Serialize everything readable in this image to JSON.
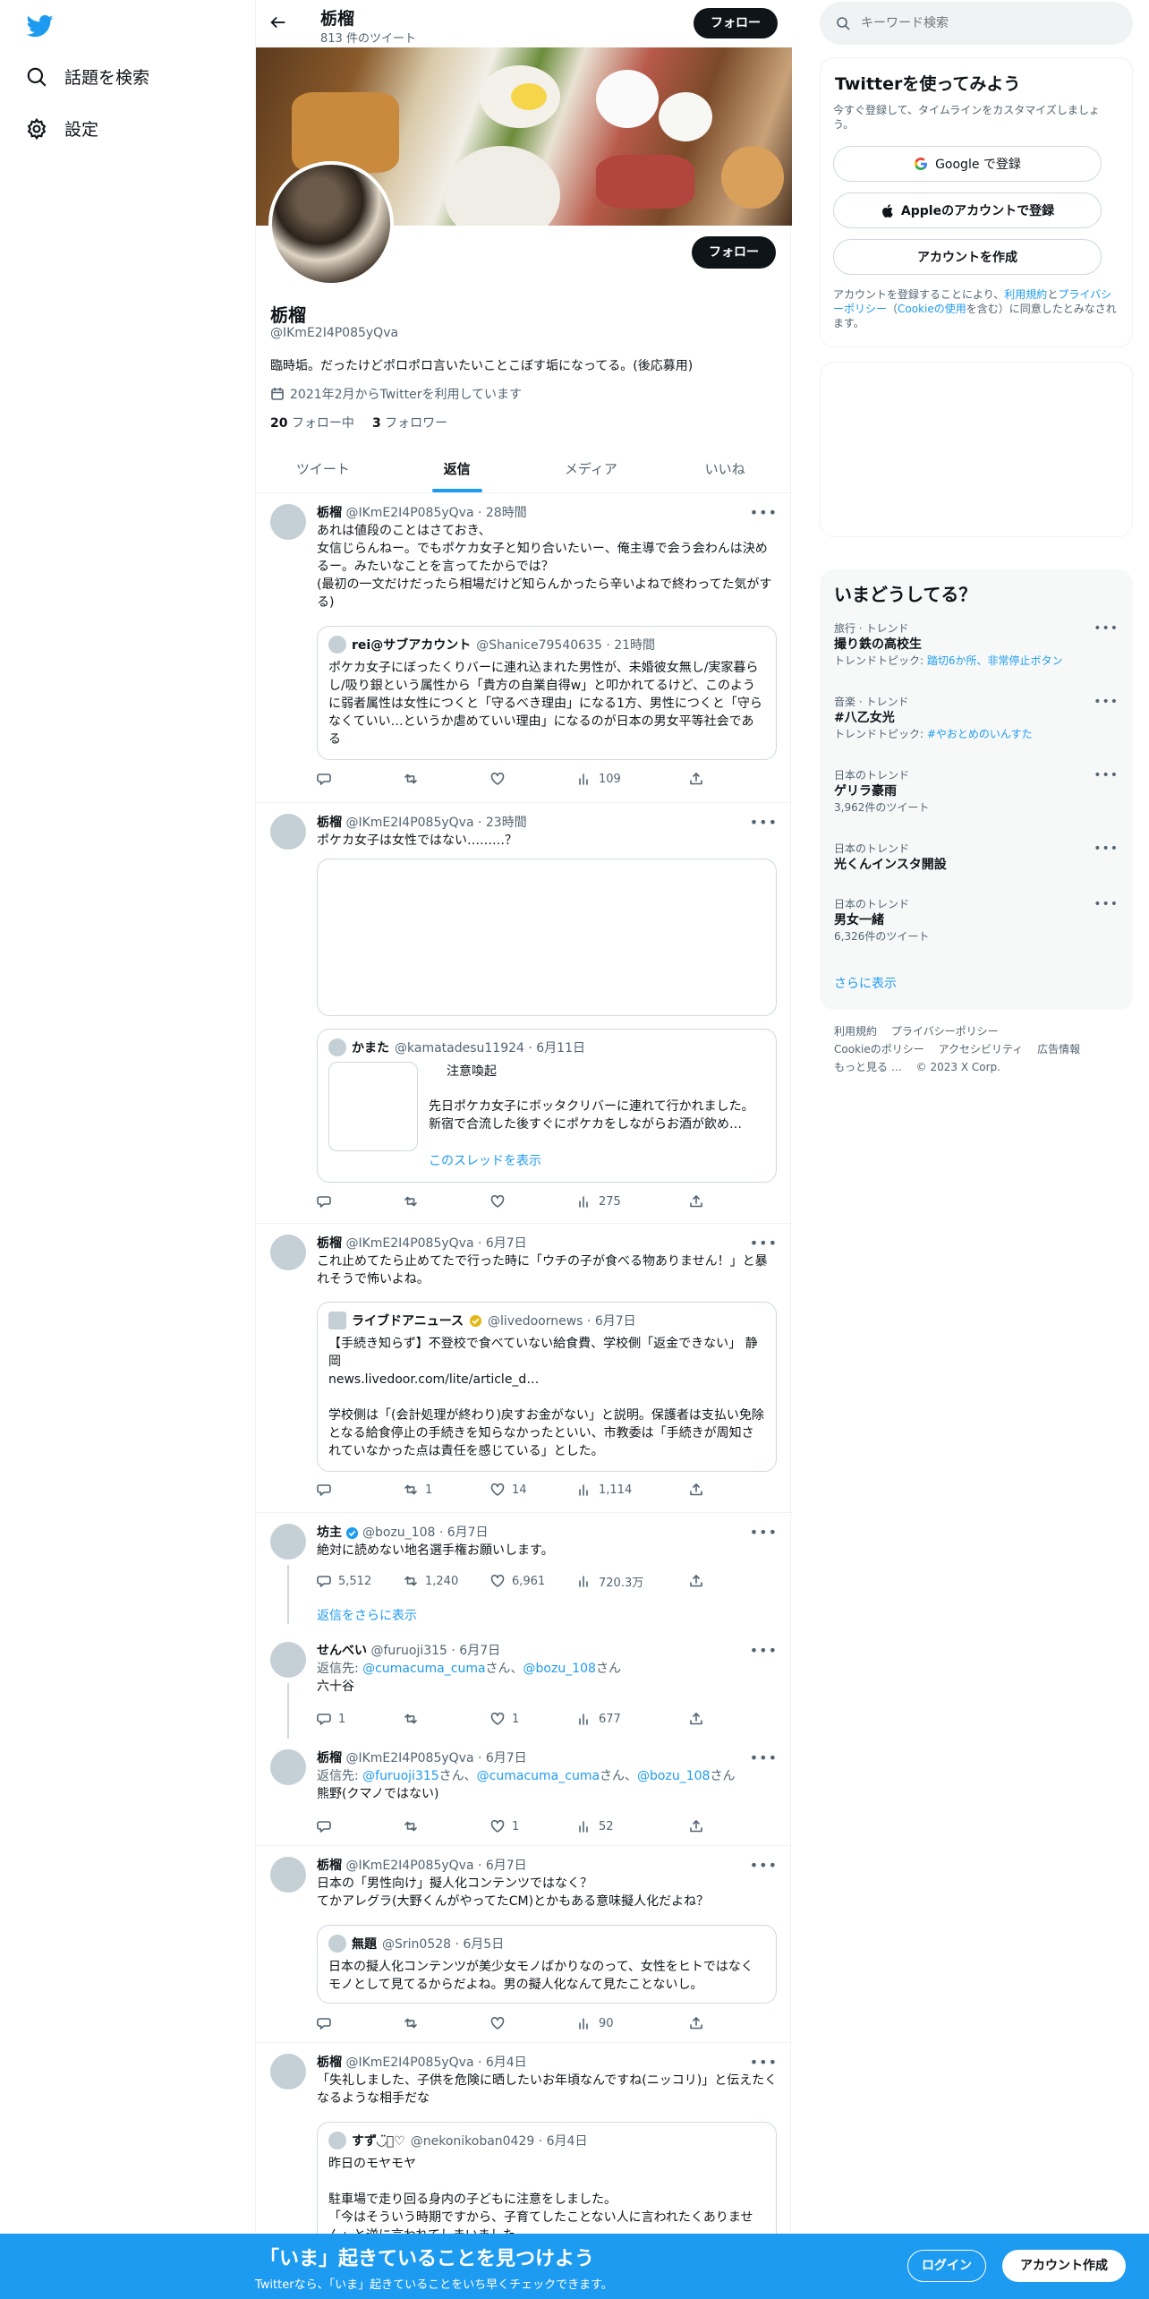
{
  "nav": {
    "explore": "話題を検索",
    "settings": "設定"
  },
  "header": {
    "name": "栃榴",
    "tweet_count": "813 件のツイート",
    "follow": "フォロー"
  },
  "profile": {
    "name": "栃榴",
    "handle": "@IKmE2I4P085yQva",
    "bio": "臨時垢。だったけどポロポロ言いたいことこぼす垢になってる。(後応募用)",
    "joined": "2021年2月からTwitterを利用しています",
    "following_count": "20",
    "following_label": "フォロー中",
    "followers_count": "3",
    "followers_label": "フォロワー",
    "follow": "フォロー"
  },
  "tabs": [
    "ツイート",
    "返信",
    "メディア",
    "いいね"
  ],
  "tweets": [
    {
      "name": "栃榴",
      "meta": "@IKmE2I4P085yQva · 28時間",
      "text": "あれは値段のことはさておき、\n女信じらんねー。でもポケカ女子と知り合いたいー、俺主導で会う会わんは決めるー。みたいなことを言ってたからでは？\n(最初の一文だけだったら相場だけど知らんかったら辛いよねで終わってた気がする)",
      "quote_name": "rei@サブアカウント",
      "quote_meta": "@Shanice79540635 · 21時間",
      "quote_text": "ポケカ女子にぼったくりバーに連れ込まれた男性が、未婚彼女無し/実家暮らし/吸り銀という属性から「貴方の自業自得w」と叩かれてるけど、このように弱者属性は女性につくと「守るべき理由」になる1方、男性につくと「守らなくていい…というか虐めていい理由」になるのが日本の男女平等社会である",
      "views": "109"
    },
    {
      "name": "栃榴",
      "meta": "@IKmE2I4P085yQva · 23時間",
      "text": "ポケカ女子は女性ではない………？",
      "quote_name": "かまた",
      "quote_meta": "@kamatadesu11924 · 6月11日",
      "quote_title": "注意喚起",
      "quote_text": "先日ポケカ女子にボッタクリバーに連れて行かれました。\n新宿で合流した後すぐにポケカをしながらお酒が飲め…",
      "show_thread": "このスレッドを表示",
      "views": "275"
    },
    {
      "name": "栃榴",
      "meta": "@IKmE2I4P085yQva · 6月7日",
      "text": "これ止めてたら止めてたで行った時に「ウチの子が食べる物ありません！」と暴れそうで怖いよね。",
      "quote_name": "ライブドアニュース",
      "quote_meta": "@livedoornews · 6月7日",
      "quote_text": "【手続き知らず】不登校で食べていない給食費、学校側「返金できない」 静岡\nnews.livedoor.com/lite/article_d…\n\n学校側は「(会計処理が終わり)戻すお金がない」と説明。保護者は支払い免除となる給食停止の手続きを知らなかったといい、市教委は「手続きが周知されていなかった点は責任を感じている」とした。",
      "retweets": "1",
      "likes": "14",
      "views": "1,114"
    },
    {
      "name": "坊主",
      "meta": "@bozu_108 · 6月7日",
      "text": "絶対に読めない地名選手権お願いします。",
      "replies": "5,512",
      "retweets": "1,240",
      "likes": "6,961",
      "views": "720.3万",
      "show_more": "返信をさらに表示"
    },
    {
      "name": "せんべい",
      "meta": "@furuoji315 · 6月7日",
      "reply_prefix": "返信先: ",
      "reply_to_1": "@cumacuma_cuma",
      "reply_san_1": "さん、",
      "reply_to_2": "@bozu_108",
      "reply_san_2": "さん",
      "text": "六十谷",
      "replies": "1",
      "likes": "1",
      "views": "677"
    },
    {
      "name": "栃榴",
      "meta": "@IKmE2I4P085yQva · 6月7日",
      "reply_prefix": "返信先: ",
      "reply_to_1": "@furuoji315",
      "reply_san_1": "さん、",
      "reply_to_2": "@cumacuma_cuma",
      "reply_san_2": "さん、",
      "reply_to_3": "@bozu_108",
      "reply_san_3": "さん",
      "text": "熊野(クマノではない)",
      "likes": "1",
      "views": "52"
    },
    {
      "name": "栃榴",
      "meta": "@IKmE2I4P085yQva · 6月7日",
      "text": "日本の「男性向け」擬人化コンテンツではなく？\nてかアレグラ(大野くんがやってたCM)とかもある意味擬人化だよね？",
      "quote_name": "無題",
      "quote_meta": "@Srin0528 · 6月5日",
      "quote_text": "日本の擬人化コンテンツが美少女モノばかりなのって、女性をヒトではなくモノとして見てるからだよね。男の擬人化なんて見たことないし。",
      "views": "90"
    },
    {
      "name": "栃榴",
      "meta": "@IKmE2I4P085yQva · 6月4日",
      "text": "「失礼しました、子供を危険に晒したいお年頃なんですね(ニッコリ)」と伝えたくなるような相手だな",
      "quote_name": "すず◡̈⃝♡",
      "quote_meta": "@nekonikoban0429 · 6月4日",
      "quote_text": "昨日のモヤモヤ\n\n駐車場で走り回る身内の子どもに注意をしました。\n「今はそういう時期ですから、子育てしたことない人に言われたくありません」と逆に言われてしまいました。"
    }
  ],
  "right": {
    "search_placeholder": "キーワード検索",
    "signup_title": "Twitterを使ってみよう",
    "signup_desc": "今すぐ登録して、タイムラインをカスタマイズしましょう。",
    "google": "Google で登録",
    "apple": "Appleのアカウントで登録",
    "create": "アカウントを作成",
    "terms_1": "アカウントを登録することにより、",
    "terms_link_1": "利用規約",
    "terms_2": "と",
    "terms_link_2": "プライバシーポリシー",
    "terms_3": "（",
    "terms_link_3": "Cookieの使用",
    "terms_4": "を含む）に同意したとみなされます。",
    "trends_title": "いまどうしてる？",
    "trends": [
      {
        "category": "旅行 · トレンド",
        "name": "撮り鉄の高校生",
        "topic_prefix": "トレンドトピック: ",
        "topic": "踏切6か所、非常停止ボタン"
      },
      {
        "category": "音楽 · トレンド",
        "name": "#八乙女光",
        "topic_prefix": "トレンドトピック: ",
        "topic": "#やおとめのいんすた"
      },
      {
        "category": "日本のトレンド",
        "name": "ゲリラ豪雨",
        "count": "3,962件のツイート"
      },
      {
        "category": "日本のトレンド",
        "name": "光くんインスタ開設"
      },
      {
        "category": "日本のトレンド",
        "name": "男女一緒",
        "count": "6,326件のツイート"
      }
    ],
    "show_more": "さらに表示",
    "footer": [
      "利用規約",
      "プライバシーポリシー",
      "Cookieのポリシー",
      "アクセシビリティ",
      "広告情報",
      "もっと見る …",
      "© 2023 X Corp."
    ]
  },
  "bottom": {
    "title": "「いま」起きていることを見つけよう",
    "subtitle": "Twitterなら、「いま」起きていることをいち早くチェックできます。",
    "login": "ログイン",
    "signup": "アカウント作成"
  },
  "colors": {
    "accent": "#1d9bf0",
    "text": "#0f1419",
    "muted": "#536471"
  }
}
